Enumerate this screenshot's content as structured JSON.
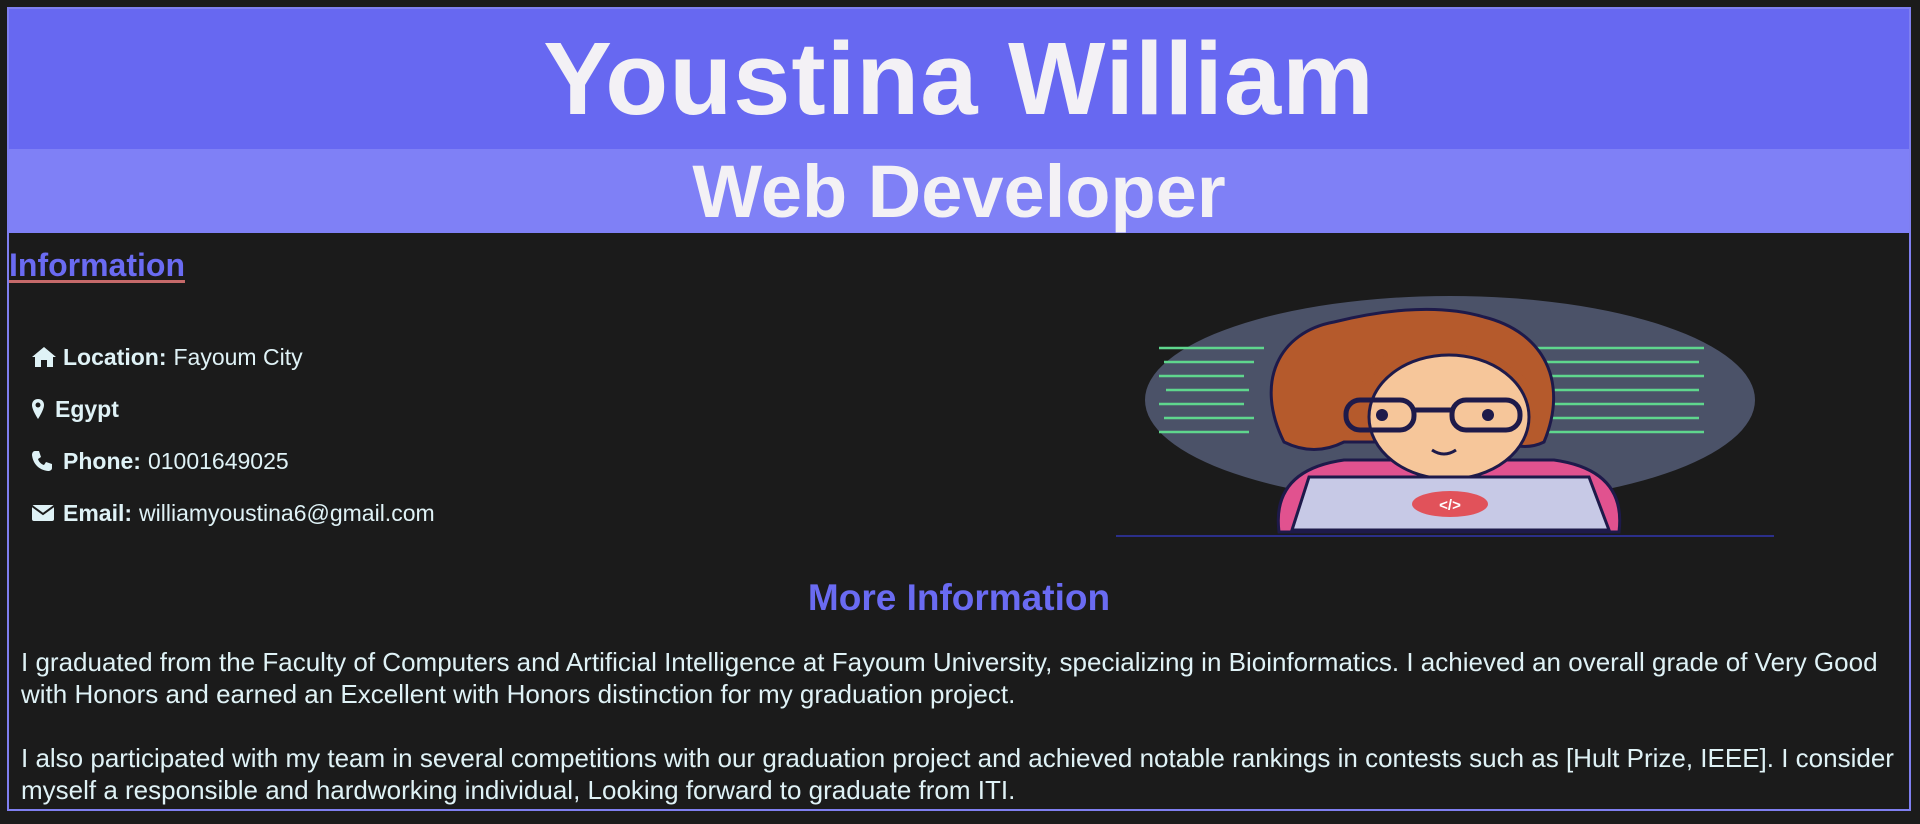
{
  "header": {
    "name": "Youstina William",
    "title": "Web Developer"
  },
  "information": {
    "heading": "Information",
    "items": [
      {
        "icon": "home-icon",
        "label": "Location:",
        "value": "Fayoum City"
      },
      {
        "icon": "map-marker-icon",
        "label": "Egypt",
        "value": ""
      },
      {
        "icon": "phone-icon",
        "label": "Phone:",
        "value": "01001649025"
      },
      {
        "icon": "envelope-icon",
        "label": "Email:",
        "value": "williamyoustina6@gmail.com"
      }
    ]
  },
  "more_information": {
    "heading": "More Information",
    "paragraphs": [
      "I graduated from the Faculty of Computers and Artificial Intelligence at Fayoum University, specializing in Bioinformatics. I achieved an overall grade of Very Good with Honors and earned an Excellent with Honors distinction for my graduation project.",
      "I also participated with my team in several competitions with our graduation project and achieved notable rankings in contests such as [Hult Prize, IEEE]. I consider myself a responsible and hardworking individual, Looking forward to graduate from ITI."
    ]
  },
  "colors": {
    "accent": "#6768f1",
    "accent_light": "#7f80f6",
    "background": "#1b1b1b",
    "text": "#dff2f6"
  }
}
